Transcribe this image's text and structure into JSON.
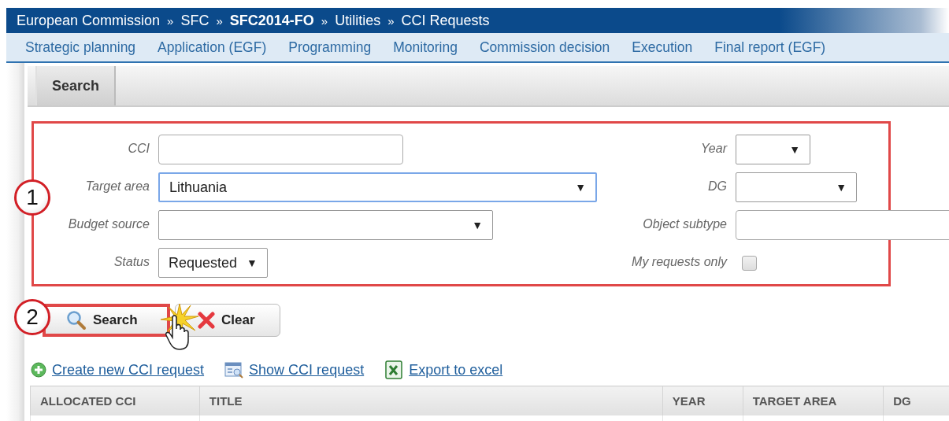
{
  "breadcrumb": [
    {
      "label": "European Commission",
      "emphasized": false
    },
    {
      "label": "SFC",
      "emphasized": false
    },
    {
      "label": "SFC2014-FO",
      "emphasized": true
    },
    {
      "label": "Utilities",
      "emphasized": false
    },
    {
      "label": "CCI Requests",
      "emphasized": false
    }
  ],
  "breadcrumb_separator": "»",
  "menu": [
    "Strategic planning",
    "Application (EGF)",
    "Programming",
    "Monitoring",
    "Commission decision",
    "Execution",
    "Final report (EGF)"
  ],
  "tabs": [
    {
      "label": "Search",
      "selected": true
    }
  ],
  "form": {
    "highlighted": true,
    "callout": "1",
    "rows": [
      {
        "left": {
          "kind": "text",
          "label": "CCI"
        },
        "right": {
          "kind": "select",
          "label": "Year",
          "focused": false
        }
      },
      {
        "left": {
          "kind": "select",
          "label": "Target area",
          "value": "Lithuania",
          "focused": true
        },
        "right": {
          "kind": "select",
          "label": "DG",
          "focused": false
        }
      },
      {
        "left": {
          "kind": "select",
          "label": "Budget source",
          "focused": false
        },
        "right": {
          "kind": "text",
          "label": "Object subtype"
        }
      },
      {
        "left": {
          "kind": "select",
          "label": "Status",
          "value": "Requested",
          "focused": false
        },
        "right": {
          "kind": "checkbox",
          "label": "My requests only",
          "checked": false
        }
      }
    ]
  },
  "dropdown_arrow": "▼",
  "actions": {
    "callout": "2",
    "buttons": [
      {
        "kind": "search",
        "label": "Search",
        "highlighted": true,
        "clicked": true
      },
      {
        "kind": "clear",
        "label": "Clear",
        "highlighted": false,
        "clicked": false
      }
    ]
  },
  "links": [
    {
      "kind": "create",
      "label": "Create new CCI request"
    },
    {
      "kind": "show",
      "label": "Show CCI request"
    },
    {
      "kind": "excel",
      "label": "Export to excel"
    }
  ],
  "table": {
    "columns": [
      "ALLOCATED CCI",
      "TITLE",
      "YEAR",
      "TARGET AREA",
      "DG"
    ]
  }
}
